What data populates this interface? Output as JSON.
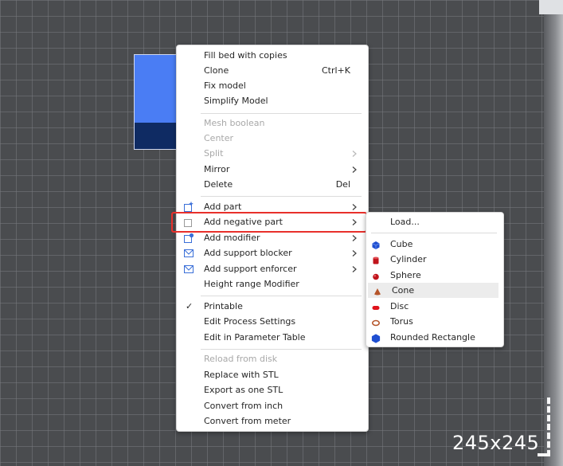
{
  "viewport": {
    "bed_size_label": "245x245",
    "grid_color": "#787a7e",
    "model_colors": {
      "top": "#4a7df4",
      "bottom": "#0f2b63"
    }
  },
  "context_menu": {
    "items": [
      {
        "label": "Fill bed with copies",
        "enabled": true
      },
      {
        "label": "Clone",
        "shortcut": "Ctrl+K",
        "enabled": true
      },
      {
        "label": "Fix model",
        "enabled": true
      },
      {
        "label": "Simplify Model",
        "enabled": true
      },
      {
        "label": "Mesh boolean",
        "enabled": false
      },
      {
        "label": "Center",
        "enabled": false
      },
      {
        "label": "Split",
        "enabled": false,
        "submenu": true
      },
      {
        "label": "Mirror",
        "enabled": true,
        "submenu": true
      },
      {
        "label": "Delete",
        "shortcut": "Del",
        "enabled": true
      },
      {
        "label": "Add part",
        "enabled": true,
        "submenu": true,
        "icon": "add-part-icon"
      },
      {
        "label": "Add negative part",
        "enabled": true,
        "submenu": true,
        "icon": "add-negative-part-icon",
        "highlighted": true
      },
      {
        "label": "Add modifier",
        "enabled": true,
        "submenu": true,
        "icon": "add-modifier-icon"
      },
      {
        "label": "Add support blocker",
        "enabled": true,
        "submenu": true,
        "icon": "support-blocker-icon"
      },
      {
        "label": "Add support enforcer",
        "enabled": true,
        "submenu": true,
        "icon": "support-enforcer-icon"
      },
      {
        "label": "Height range Modifier",
        "enabled": true
      },
      {
        "label": "Printable",
        "enabled": true,
        "checked": true
      },
      {
        "label": "Edit Process Settings",
        "enabled": true
      },
      {
        "label": "Edit in Parameter Table",
        "enabled": true
      },
      {
        "label": "Reload from disk",
        "enabled": false
      },
      {
        "label": "Replace with STL",
        "enabled": true
      },
      {
        "label": "Export as one STL",
        "enabled": true
      },
      {
        "label": "Convert from inch",
        "enabled": true
      },
      {
        "label": "Convert from meter",
        "enabled": true
      }
    ],
    "check_glyph": "✓",
    "highlight_color": "#e8302b"
  },
  "negative_part_submenu": {
    "items": [
      {
        "label": "Load..."
      },
      {
        "label": "Cube",
        "icon": "cube-icon",
        "color": "#1f4fd1"
      },
      {
        "label": "Cylinder",
        "icon": "cylinder-icon",
        "color": "#c0141c"
      },
      {
        "label": "Sphere",
        "icon": "sphere-icon",
        "color": "#c0141c"
      },
      {
        "label": "Cone",
        "icon": "cone-icon",
        "color": "#b5552a",
        "hovered": true
      },
      {
        "label": "Disc",
        "icon": "disc-icon",
        "color": "#e0141c"
      },
      {
        "label": "Torus",
        "icon": "torus-icon",
        "color": "#b5552a"
      },
      {
        "label": "Rounded Rectangle",
        "icon": "rounded-rectangle-icon",
        "color": "#1f4fd1"
      }
    ]
  }
}
